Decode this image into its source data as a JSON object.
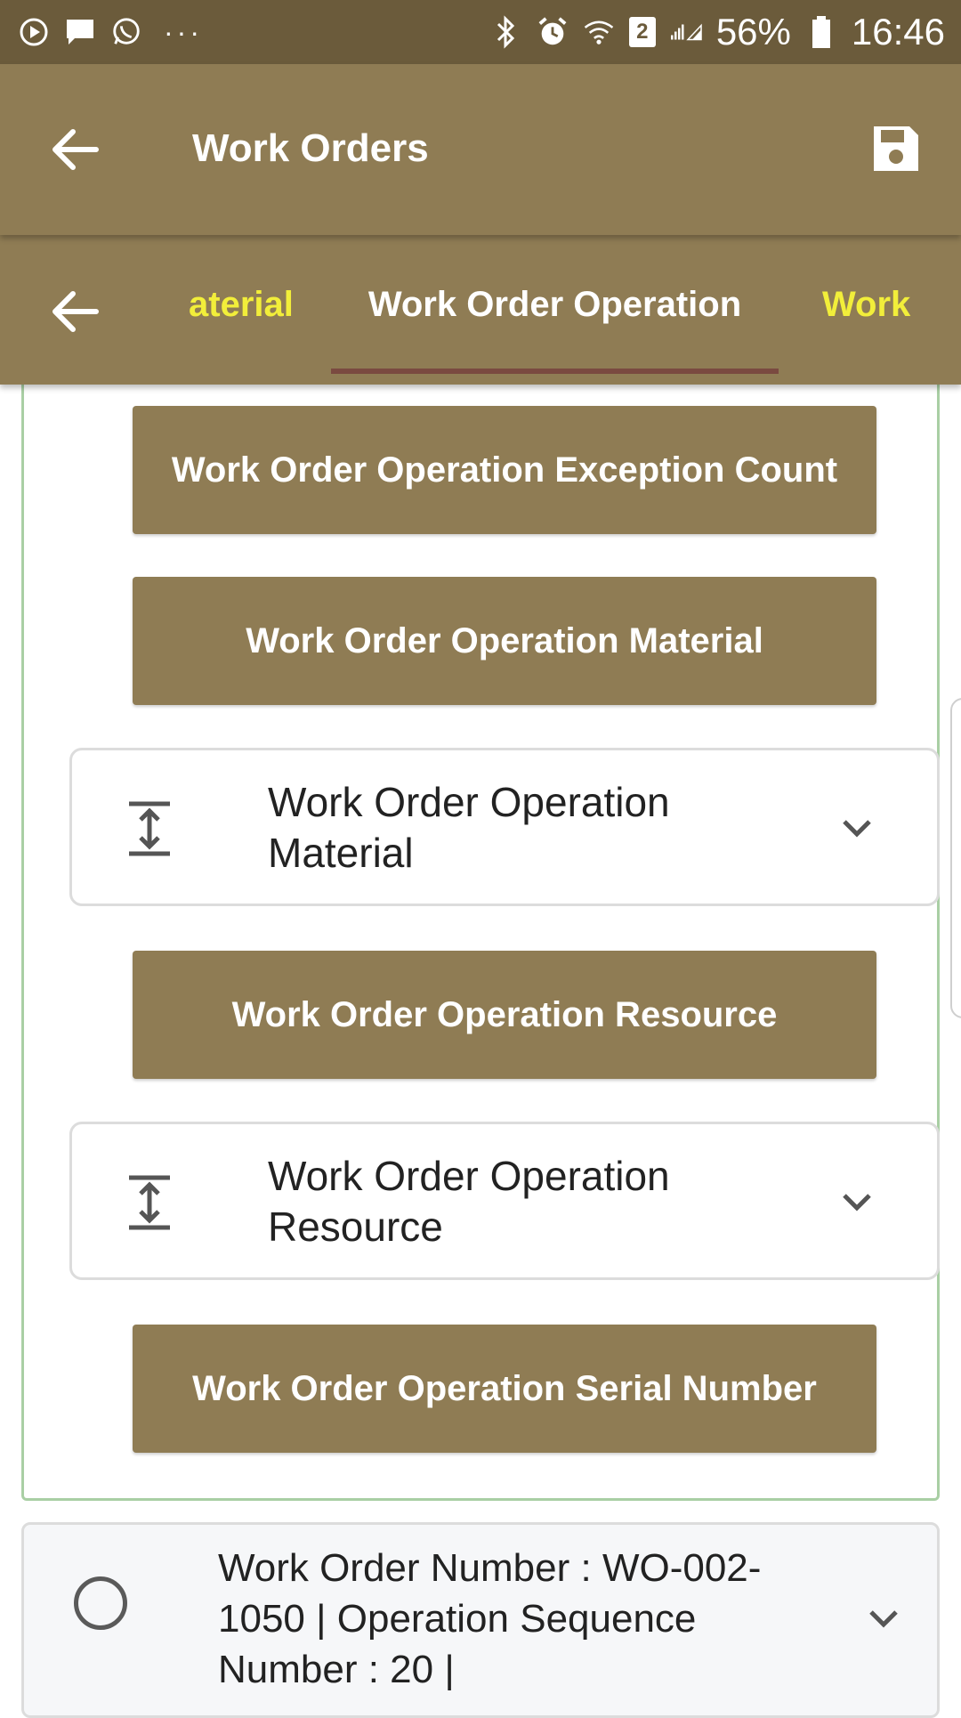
{
  "status_bar": {
    "battery": "56%",
    "time": "16:46",
    "sim_slot": "2",
    "icons": [
      "play-icon",
      "message-icon",
      "whatsapp-icon",
      "more-dots-icon",
      "bluetooth-icon",
      "alarm-icon",
      "wifi-icon",
      "signal-icon",
      "battery-icon"
    ]
  },
  "app_bar": {
    "title": "Work Orders",
    "back_icon": "back-arrow-icon",
    "save_icon": "save-icon"
  },
  "tabs": {
    "previous": "aterial",
    "active": "Work Order Operation",
    "next": "Work",
    "back_icon": "back-arrow-icon"
  },
  "content": {
    "buttons": {
      "exception_count": "Work Order Operation Exception Count",
      "material": "Work Order Operation Material",
      "resource": "Work Order Operation Resource",
      "serial_number": "Work Order Operation Serial Number"
    },
    "expanders": {
      "material": "Work Order Operation Material",
      "resource": "Work Order Operation Resource"
    }
  },
  "record": {
    "text": "Work Order Number : WO-002-1050 | Operation Sequence Number : 20 |"
  },
  "colors": {
    "status_bar": "#6b5b3b",
    "primary": "#8f7c54",
    "tab_highlight": "#f2ee3a",
    "tab_indicator": "#7a4a40",
    "card_border": "#a9cfa4"
  }
}
